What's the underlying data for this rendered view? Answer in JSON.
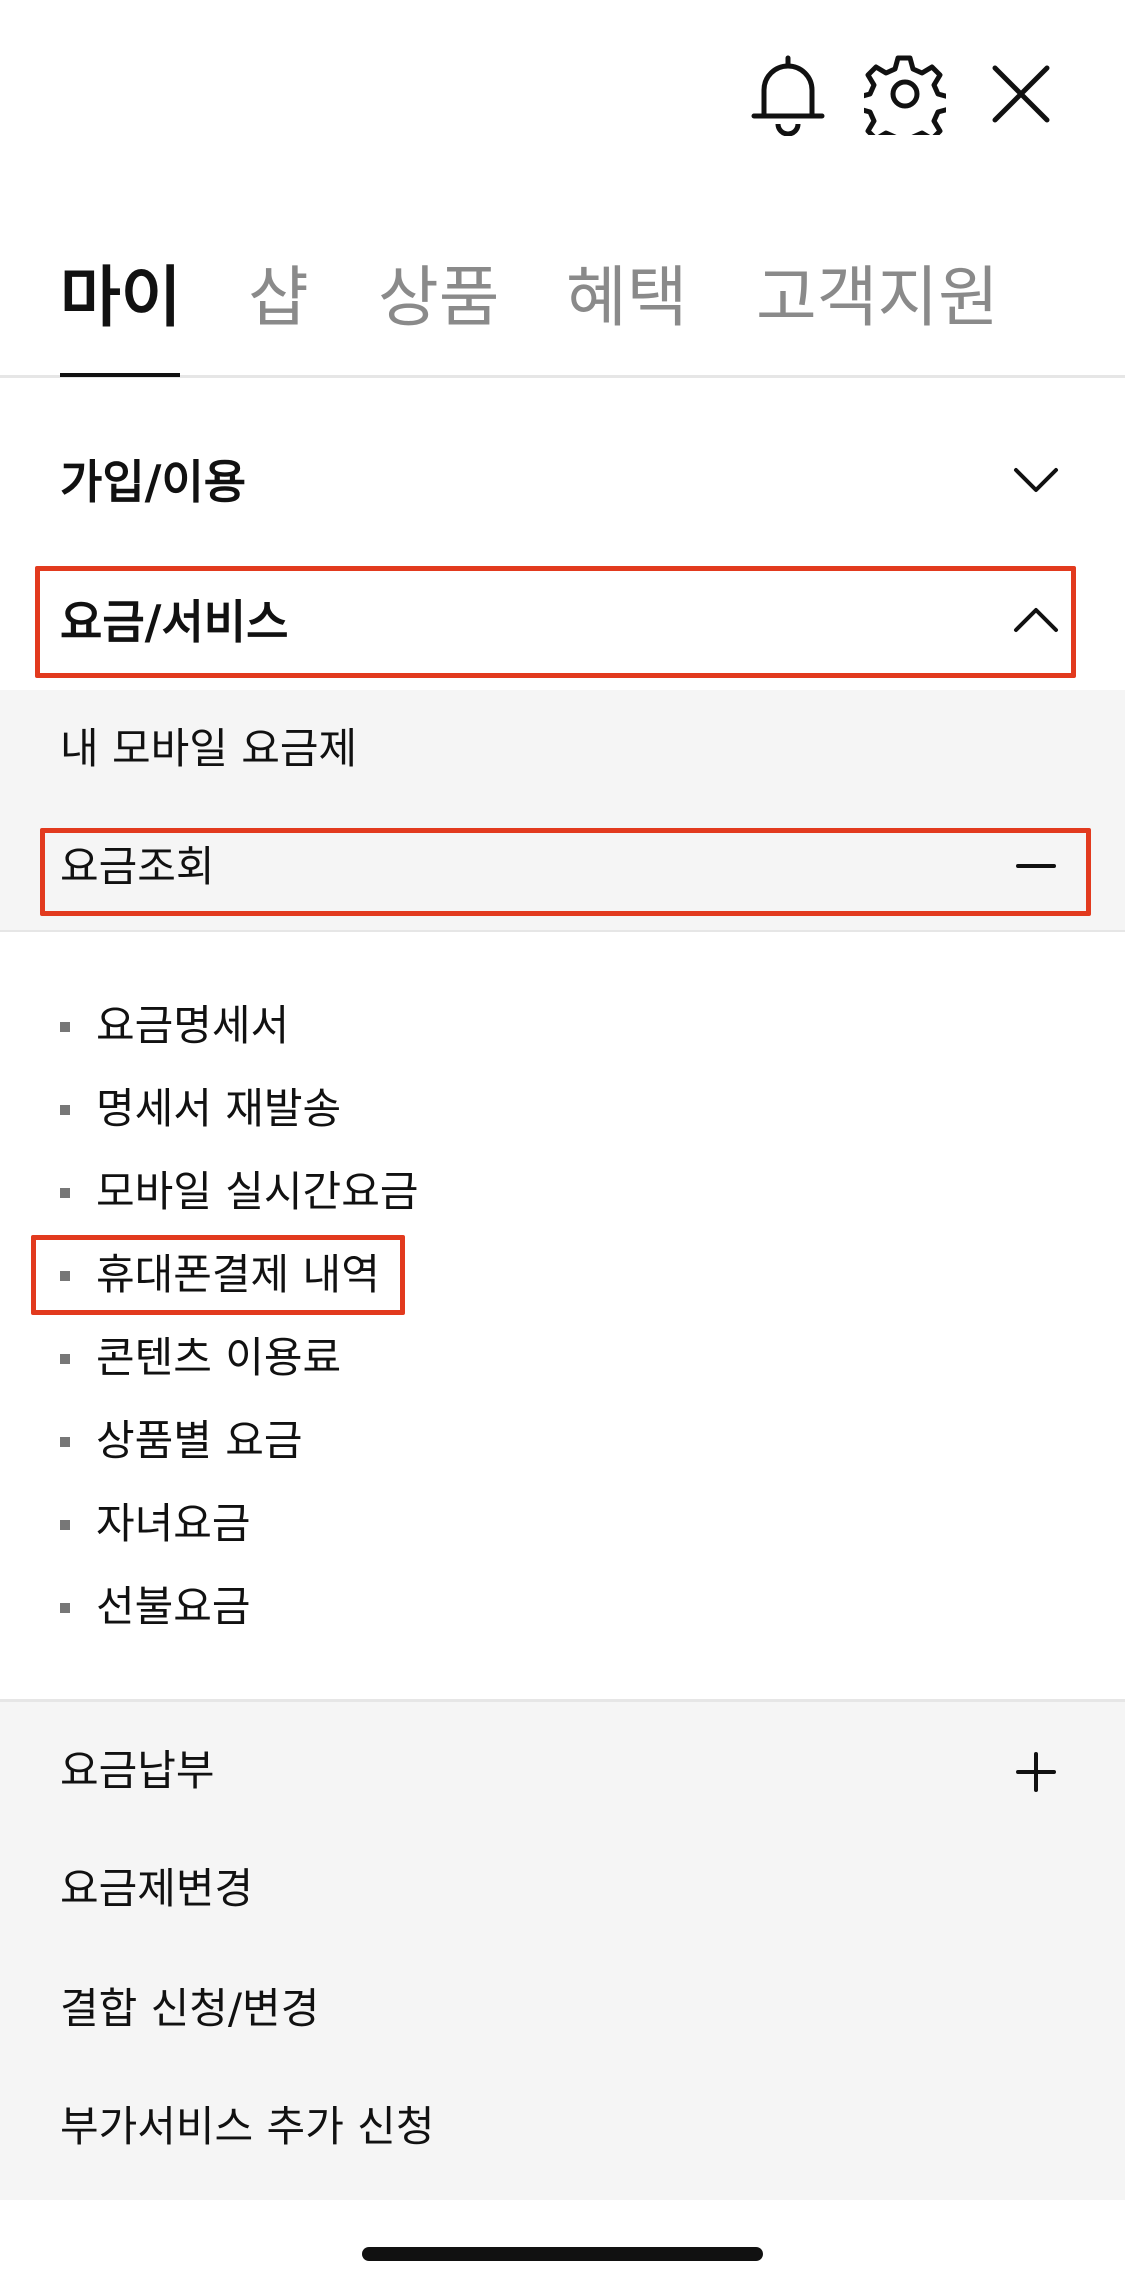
{
  "header": {
    "icons": [
      "bell-icon",
      "gear-icon",
      "close-icon"
    ]
  },
  "tabs": [
    {
      "label": "마이",
      "active": true
    },
    {
      "label": "샵",
      "active": false
    },
    {
      "label": "상품",
      "active": false
    },
    {
      "label": "혜택",
      "active": false
    },
    {
      "label": "고객지원",
      "active": false
    }
  ],
  "sections": {
    "join": {
      "label": "가입/이용",
      "state": "collapsed"
    },
    "billing": {
      "label": "요금/서비스",
      "state": "expanded"
    }
  },
  "billing_menu": {
    "my_plan": "내 모바일 요금제",
    "inquiry": {
      "label": "요금조회",
      "items": [
        "요금명세서",
        "명세서 재발송",
        "모바일 실시간요금",
        "휴대폰결제 내역",
        "콘텐츠 이용료",
        "상품별 요금",
        "자녀요금",
        "선불요금"
      ]
    },
    "payment": "요금납부",
    "plan_change": "요금제변경",
    "bundle": "결합 신청/변경",
    "addon": "부가서비스 추가 신청"
  },
  "colors": {
    "highlight": "#e23a1e",
    "grey_bg": "#f5f5f5",
    "inactive_tab": "#8a8a8a"
  }
}
